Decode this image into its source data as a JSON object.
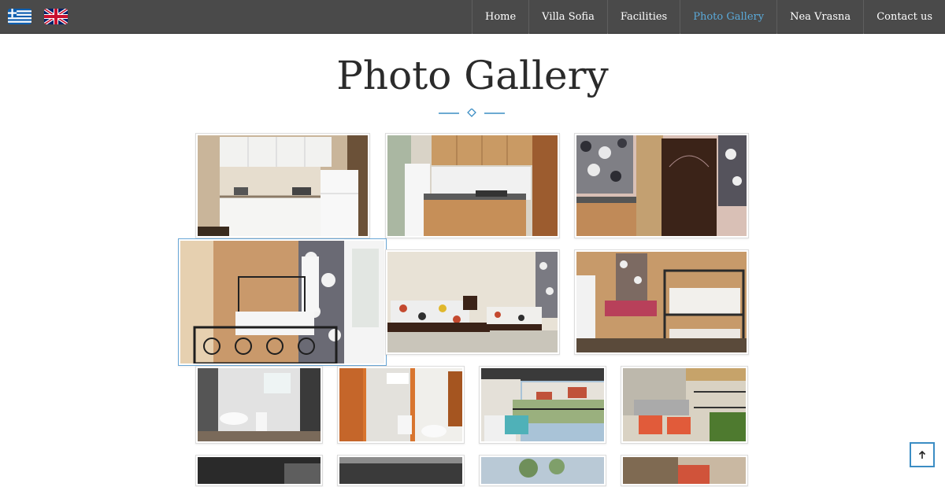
{
  "header": {
    "languages": [
      {
        "name": "greek-flag-icon",
        "code": "gr"
      },
      {
        "name": "uk-flag-icon",
        "code": "en"
      }
    ],
    "nav": [
      {
        "label": "Home",
        "active": false
      },
      {
        "label": "Villa Sofia",
        "active": false
      },
      {
        "label": "Facilities",
        "active": false
      },
      {
        "label": "Photo Gallery",
        "active": true
      },
      {
        "label": "Nea Vrasna",
        "active": false
      },
      {
        "label": "Contact us",
        "active": false
      }
    ]
  },
  "page": {
    "title": "Photo Gallery"
  },
  "gallery": {
    "photos": [
      {
        "subject": "kitchenette-white"
      },
      {
        "subject": "kitchenette-wood"
      },
      {
        "subject": "entrance-door"
      },
      {
        "subject": "bedroom-iron-bed"
      },
      {
        "subject": "bedroom-two-beds"
      },
      {
        "subject": "bedroom-bunk-bed"
      },
      {
        "subject": "bathroom-1"
      },
      {
        "subject": "bathroom-2"
      },
      {
        "subject": "balcony-view"
      },
      {
        "subject": "balcony-table"
      },
      {
        "subject": "photo-row-5-a"
      },
      {
        "subject": "photo-row-5-b"
      },
      {
        "subject": "photo-row-5-c"
      },
      {
        "subject": "photo-row-5-d"
      }
    ]
  },
  "colors": {
    "topbar": "#4a4a4a",
    "nav_text": "#ffffff",
    "nav_active": "#5aa9d9",
    "accent": "#3b8dc4",
    "title": "#2b2b2b"
  },
  "scroll_to_top": {
    "icon": "arrow-up-icon"
  }
}
